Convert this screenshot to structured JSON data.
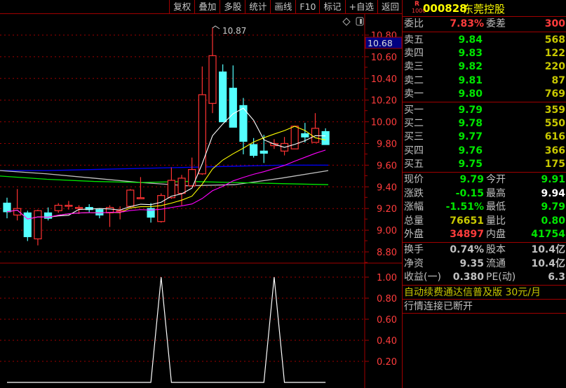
{
  "toolbar": {
    "buttons": [
      "复权",
      "叠加",
      "多股",
      "统计",
      "画线",
      "F10",
      "标记",
      "+自选",
      "返回"
    ]
  },
  "chart_icons": [
    "diamond-icon",
    "panel-toggle-icon"
  ],
  "cursor_price": "10.68",
  "high_marker": "10.87",
  "colors": {
    "up": "#ff3232",
    "down": "#54ffff",
    "ma5": "#ffffff",
    "ma10": "#ffff00",
    "ma20": "#ff00ff",
    "grid": "#a00000",
    "axis_text": "#ff3c3c"
  },
  "chart_data": [
    {
      "type": "candlestick",
      "title": "K线",
      "yaxis_ticks": [
        "10.80",
        "10.60",
        "10.40",
        "10.20",
        "10.00",
        "9.80",
        "9.60",
        "9.40",
        "9.20",
        "9.00",
        "8.80"
      ],
      "ylim": [
        8.8,
        10.8
      ],
      "candles": [
        [
          9.25,
          9.17,
          9.3,
          9.11
        ],
        [
          9.14,
          9.2,
          9.38,
          9.09
        ],
        [
          9.16,
          8.94,
          9.18,
          8.9
        ],
        [
          8.92,
          9.18,
          9.19,
          8.86
        ],
        [
          9.16,
          9.11,
          9.21,
          9.09
        ],
        [
          9.18,
          9.23,
          9.25,
          9.16
        ],
        [
          9.23,
          9.23,
          9.27,
          9.19
        ],
        [
          9.21,
          9.21,
          9.23,
          9.15
        ],
        [
          9.21,
          9.19,
          9.24,
          9.16
        ],
        [
          9.19,
          9.14,
          9.2,
          9.11
        ],
        [
          9.16,
          9.21,
          9.23,
          9.03
        ],
        [
          9.18,
          9.18,
          9.22,
          9.1
        ],
        [
          9.22,
          9.37,
          9.38,
          9.21
        ],
        [
          9.3,
          9.3,
          9.49,
          9.3
        ],
        [
          9.2,
          9.12,
          9.25,
          9.07
        ],
        [
          9.08,
          9.32,
          9.34,
          9.07
        ],
        [
          9.3,
          9.46,
          9.58,
          9.29
        ],
        [
          9.34,
          9.48,
          9.51,
          9.23
        ],
        [
          9.41,
          9.56,
          9.67,
          9.4
        ],
        [
          9.52,
          10.25,
          10.51,
          9.51
        ],
        [
          10.17,
          10.61,
          10.87,
          10.08
        ],
        [
          10.46,
          10.0,
          10.53,
          10.0
        ],
        [
          10.31,
          9.95,
          10.52,
          9.95
        ],
        [
          10.15,
          9.82,
          10.22,
          9.7
        ],
        [
          9.79,
          9.69,
          9.85,
          9.67
        ],
        [
          9.73,
          9.71,
          9.88,
          9.62
        ],
        [
          9.78,
          9.8,
          9.84,
          9.75
        ],
        [
          9.73,
          9.8,
          9.86,
          9.69
        ],
        [
          9.75,
          9.96,
          9.96,
          9.75
        ],
        [
          9.89,
          9.86,
          9.99,
          9.81
        ],
        [
          9.81,
          9.94,
          10.08,
          9.81
        ],
        [
          9.91,
          9.79,
          9.94,
          9.79
        ]
      ],
      "long_mas": [
        {
          "name": "blue",
          "color": "#0000ff",
          "values": [
            9.55,
            9.55,
            9.56,
            9.57,
            9.58,
            9.59,
            9.6,
            9.6
          ]
        },
        {
          "name": "grey",
          "color": "#c0c0c0",
          "values": [
            9.55,
            9.52,
            9.48,
            9.44,
            9.41,
            9.42,
            9.48,
            9.55
          ]
        },
        {
          "name": "green",
          "color": "#00e600",
          "values": [
            9.5,
            9.47,
            9.45,
            9.44,
            9.45,
            9.44,
            9.43,
            9.42
          ]
        }
      ]
    },
    {
      "type": "line",
      "title": "指标",
      "yaxis_ticks": [
        "1.00",
        "0.80",
        "0.60",
        "0.40",
        "0.20"
      ],
      "ylim": [
        0,
        1.05
      ],
      "values": [
        0,
        0,
        0,
        0,
        0,
        0,
        0,
        0,
        0,
        0,
        0,
        0,
        0,
        0,
        0,
        1,
        0,
        0,
        0,
        0,
        0,
        0,
        0,
        0,
        0,
        0,
        1,
        0,
        0,
        0,
        0,
        0
      ]
    }
  ],
  "quote": {
    "code": "000828",
    "name": "东莞控股",
    "badge_r": "R",
    "badge_num": "1000",
    "weibi_label": "委比",
    "weibi": "7.83%",
    "weicha_label": "委差",
    "weicha": "300",
    "sells": [
      {
        "label": "卖五",
        "price": "9.84",
        "vol": "568"
      },
      {
        "label": "卖四",
        "price": "9.83",
        "vol": "122"
      },
      {
        "label": "卖三",
        "price": "9.82",
        "vol": "220"
      },
      {
        "label": "卖二",
        "price": "9.81",
        "vol": "87"
      },
      {
        "label": "卖一",
        "price": "9.80",
        "vol": "769"
      }
    ],
    "buys": [
      {
        "label": "买一",
        "price": "9.79",
        "vol": "359"
      },
      {
        "label": "买二",
        "price": "9.78",
        "vol": "550"
      },
      {
        "label": "买三",
        "price": "9.77",
        "vol": "616"
      },
      {
        "label": "买四",
        "price": "9.76",
        "vol": "366"
      },
      {
        "label": "买五",
        "price": "9.75",
        "vol": "175"
      }
    ],
    "stats": [
      {
        "l": "现价",
        "v": "9.79",
        "vc": "g",
        "l2": "今开",
        "v2": "9.91",
        "v2c": "g"
      },
      {
        "l": "涨跌",
        "v": "-0.15",
        "vc": "g",
        "l2": "最高",
        "v2": "9.94",
        "v2c": "w"
      },
      {
        "l": "涨幅",
        "v": "-1.51%",
        "vc": "g",
        "l2": "最低",
        "v2": "9.79",
        "v2c": "g"
      },
      {
        "l": "总量",
        "v": "76651",
        "vc": "y",
        "l2": "量比",
        "v2": "0.80",
        "v2c": "g"
      },
      {
        "l": "外盘",
        "v": "34897",
        "vc": "rd",
        "l2": "内盘",
        "v2": "41754",
        "v2c": "g"
      }
    ],
    "fin": [
      {
        "l": "换手",
        "v": "0.74%",
        "l2": "股本",
        "v2": "10.4亿"
      },
      {
        "l": "净资",
        "v": "9.35",
        "l2": "流通",
        "v2": "10.4亿"
      },
      {
        "l": "收益(一)",
        "v": "0.380",
        "l2": "PE(动)",
        "v2": "6.3"
      }
    ],
    "ad": "自动续费通达信普及版  30元/月",
    "status": "行情连接已断开"
  }
}
